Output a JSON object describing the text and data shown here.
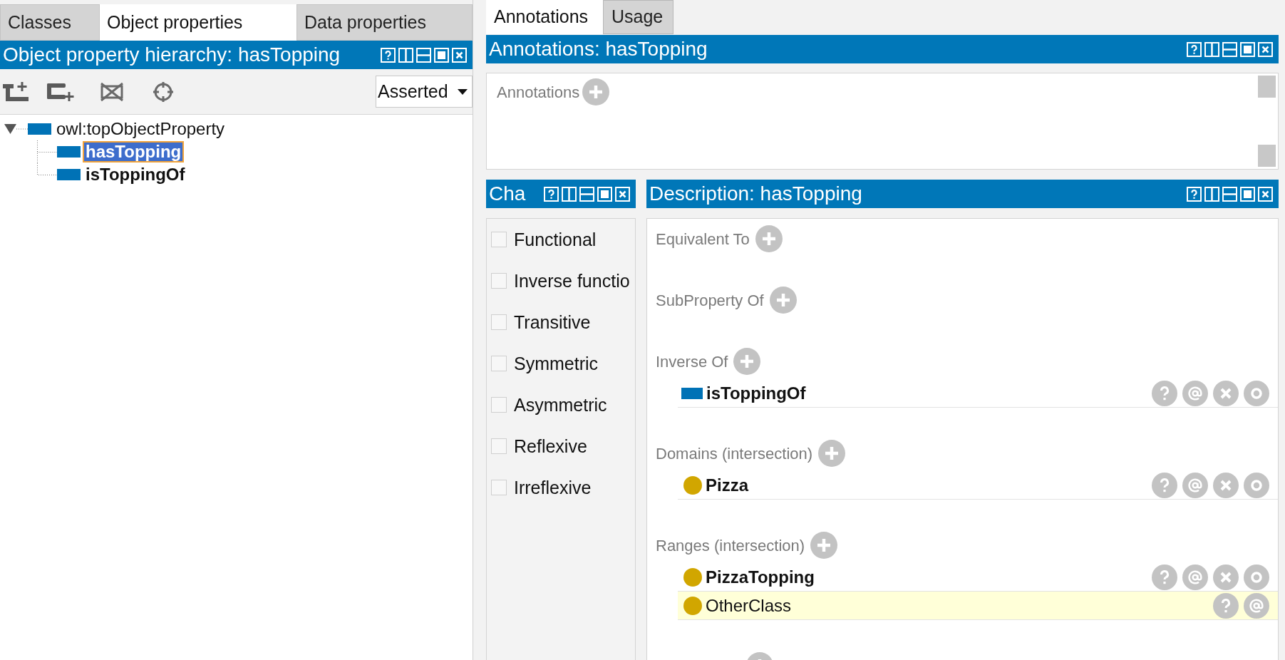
{
  "left_panel": {
    "tabs": [
      {
        "label": "Classes",
        "selected": false
      },
      {
        "label": "Object properties",
        "selected": true
      },
      {
        "label": "Data properties",
        "selected": false
      }
    ],
    "hierarchy_view": {
      "title": "Object property hierarchy: hasTopping",
      "mode_dropdown": "Asserted",
      "tree": [
        {
          "label": "owl:topObjectProperty",
          "bold": false,
          "selected": false,
          "expanded": true,
          "children": [
            {
              "label": "hasTopping",
              "bold": true,
              "selected": true
            },
            {
              "label": "isToppingOf",
              "bold": true,
              "selected": false
            }
          ]
        }
      ]
    }
  },
  "right_panel": {
    "tabs": [
      {
        "label": "Annotations",
        "selected": true
      },
      {
        "label": "Usage",
        "selected": false
      }
    ],
    "annotations_view": {
      "title": "Annotations: hasTopping",
      "label": "Annotations"
    },
    "characteristics_view": {
      "title": "Cha",
      "items": [
        {
          "label": "Functional",
          "checked": false
        },
        {
          "label": "Inverse functio",
          "checked": false
        },
        {
          "label": "Transitive",
          "checked": false
        },
        {
          "label": "Symmetric",
          "checked": false
        },
        {
          "label": "Asymmetric",
          "checked": false
        },
        {
          "label": "Reflexive",
          "checked": false
        },
        {
          "label": "Irreflexive",
          "checked": false
        }
      ]
    },
    "description_view": {
      "title": "Description: hasTopping",
      "sections": [
        {
          "label": "Equivalent To"
        },
        {
          "label": "SubProperty Of"
        },
        {
          "label": "Inverse Of",
          "items": [
            {
              "kind": "property",
              "label": "isToppingOf",
              "bold": true,
              "inferred": false
            }
          ]
        },
        {
          "label": "Domains (intersection)",
          "items": [
            {
              "kind": "class",
              "label": "Pizza",
              "bold": true,
              "inferred": false
            }
          ]
        },
        {
          "label": "Ranges (intersection)",
          "items": [
            {
              "kind": "class",
              "label": "PizzaTopping",
              "bold": true,
              "inferred": false
            },
            {
              "kind": "class",
              "label": "OtherClass",
              "bold": false,
              "inferred": true
            }
          ]
        }
      ]
    }
  }
}
